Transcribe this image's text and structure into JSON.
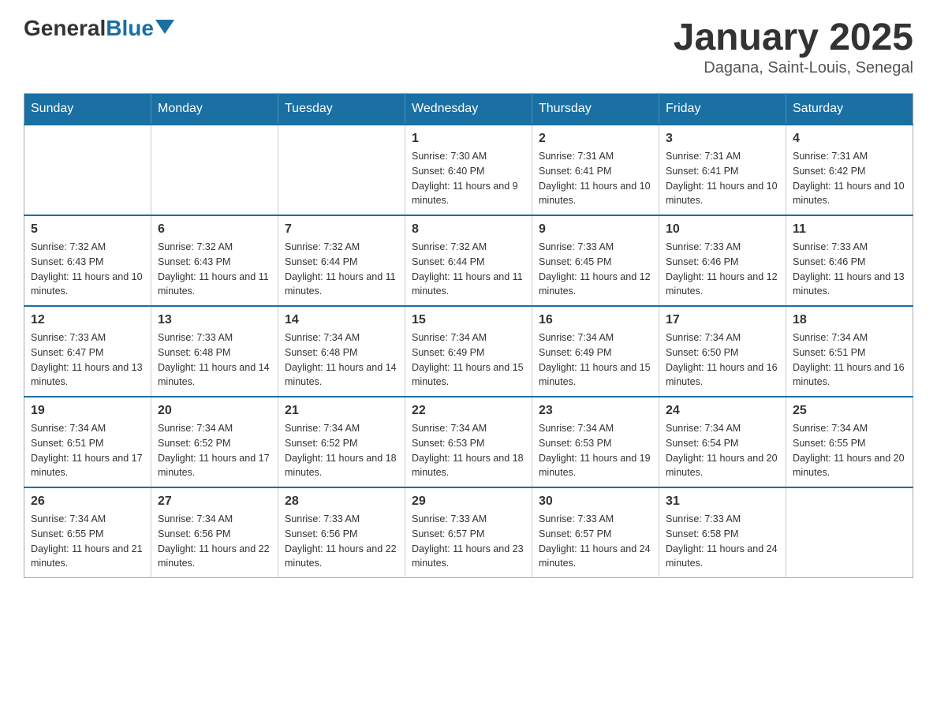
{
  "header": {
    "logo_general": "General",
    "logo_blue": "Blue",
    "month_title": "January 2025",
    "location": "Dagana, Saint-Louis, Senegal"
  },
  "calendar": {
    "days_of_week": [
      "Sunday",
      "Monday",
      "Tuesday",
      "Wednesday",
      "Thursday",
      "Friday",
      "Saturday"
    ],
    "weeks": [
      [
        {
          "day": "",
          "info": ""
        },
        {
          "day": "",
          "info": ""
        },
        {
          "day": "",
          "info": ""
        },
        {
          "day": "1",
          "info": "Sunrise: 7:30 AM\nSunset: 6:40 PM\nDaylight: 11 hours and 9 minutes."
        },
        {
          "day": "2",
          "info": "Sunrise: 7:31 AM\nSunset: 6:41 PM\nDaylight: 11 hours and 10 minutes."
        },
        {
          "day": "3",
          "info": "Sunrise: 7:31 AM\nSunset: 6:41 PM\nDaylight: 11 hours and 10 minutes."
        },
        {
          "day": "4",
          "info": "Sunrise: 7:31 AM\nSunset: 6:42 PM\nDaylight: 11 hours and 10 minutes."
        }
      ],
      [
        {
          "day": "5",
          "info": "Sunrise: 7:32 AM\nSunset: 6:43 PM\nDaylight: 11 hours and 10 minutes."
        },
        {
          "day": "6",
          "info": "Sunrise: 7:32 AM\nSunset: 6:43 PM\nDaylight: 11 hours and 11 minutes."
        },
        {
          "day": "7",
          "info": "Sunrise: 7:32 AM\nSunset: 6:44 PM\nDaylight: 11 hours and 11 minutes."
        },
        {
          "day": "8",
          "info": "Sunrise: 7:32 AM\nSunset: 6:44 PM\nDaylight: 11 hours and 11 minutes."
        },
        {
          "day": "9",
          "info": "Sunrise: 7:33 AM\nSunset: 6:45 PM\nDaylight: 11 hours and 12 minutes."
        },
        {
          "day": "10",
          "info": "Sunrise: 7:33 AM\nSunset: 6:46 PM\nDaylight: 11 hours and 12 minutes."
        },
        {
          "day": "11",
          "info": "Sunrise: 7:33 AM\nSunset: 6:46 PM\nDaylight: 11 hours and 13 minutes."
        }
      ],
      [
        {
          "day": "12",
          "info": "Sunrise: 7:33 AM\nSunset: 6:47 PM\nDaylight: 11 hours and 13 minutes."
        },
        {
          "day": "13",
          "info": "Sunrise: 7:33 AM\nSunset: 6:48 PM\nDaylight: 11 hours and 14 minutes."
        },
        {
          "day": "14",
          "info": "Sunrise: 7:34 AM\nSunset: 6:48 PM\nDaylight: 11 hours and 14 minutes."
        },
        {
          "day": "15",
          "info": "Sunrise: 7:34 AM\nSunset: 6:49 PM\nDaylight: 11 hours and 15 minutes."
        },
        {
          "day": "16",
          "info": "Sunrise: 7:34 AM\nSunset: 6:49 PM\nDaylight: 11 hours and 15 minutes."
        },
        {
          "day": "17",
          "info": "Sunrise: 7:34 AM\nSunset: 6:50 PM\nDaylight: 11 hours and 16 minutes."
        },
        {
          "day": "18",
          "info": "Sunrise: 7:34 AM\nSunset: 6:51 PM\nDaylight: 11 hours and 16 minutes."
        }
      ],
      [
        {
          "day": "19",
          "info": "Sunrise: 7:34 AM\nSunset: 6:51 PM\nDaylight: 11 hours and 17 minutes."
        },
        {
          "day": "20",
          "info": "Sunrise: 7:34 AM\nSunset: 6:52 PM\nDaylight: 11 hours and 17 minutes."
        },
        {
          "day": "21",
          "info": "Sunrise: 7:34 AM\nSunset: 6:52 PM\nDaylight: 11 hours and 18 minutes."
        },
        {
          "day": "22",
          "info": "Sunrise: 7:34 AM\nSunset: 6:53 PM\nDaylight: 11 hours and 18 minutes."
        },
        {
          "day": "23",
          "info": "Sunrise: 7:34 AM\nSunset: 6:53 PM\nDaylight: 11 hours and 19 minutes."
        },
        {
          "day": "24",
          "info": "Sunrise: 7:34 AM\nSunset: 6:54 PM\nDaylight: 11 hours and 20 minutes."
        },
        {
          "day": "25",
          "info": "Sunrise: 7:34 AM\nSunset: 6:55 PM\nDaylight: 11 hours and 20 minutes."
        }
      ],
      [
        {
          "day": "26",
          "info": "Sunrise: 7:34 AM\nSunset: 6:55 PM\nDaylight: 11 hours and 21 minutes."
        },
        {
          "day": "27",
          "info": "Sunrise: 7:34 AM\nSunset: 6:56 PM\nDaylight: 11 hours and 22 minutes."
        },
        {
          "day": "28",
          "info": "Sunrise: 7:33 AM\nSunset: 6:56 PM\nDaylight: 11 hours and 22 minutes."
        },
        {
          "day": "29",
          "info": "Sunrise: 7:33 AM\nSunset: 6:57 PM\nDaylight: 11 hours and 23 minutes."
        },
        {
          "day": "30",
          "info": "Sunrise: 7:33 AM\nSunset: 6:57 PM\nDaylight: 11 hours and 24 minutes."
        },
        {
          "day": "31",
          "info": "Sunrise: 7:33 AM\nSunset: 6:58 PM\nDaylight: 11 hours and 24 minutes."
        },
        {
          "day": "",
          "info": ""
        }
      ]
    ]
  }
}
